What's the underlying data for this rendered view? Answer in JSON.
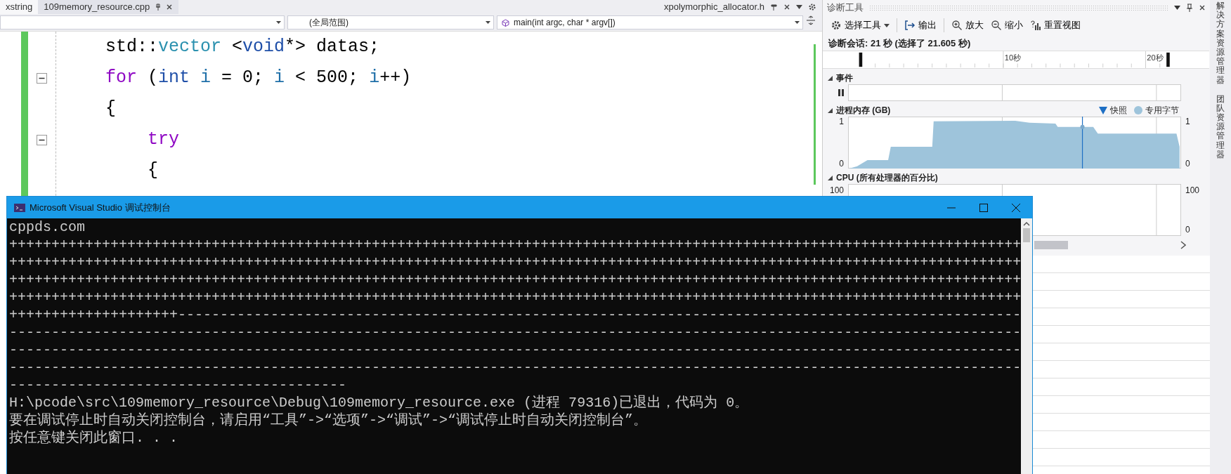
{
  "editor": {
    "tabs": [
      {
        "label": "xstring",
        "selected": false
      },
      {
        "label": "109memory_resource.cpp",
        "selected": true
      }
    ],
    "preview_tab": {
      "label": "xpolymorphic_allocator.h"
    },
    "nav": {
      "scope": "(全局范围)",
      "member": "main(int argc, char * argv[])"
    },
    "code_lines": [
      {
        "foldable": false,
        "tokens": [
          {
            "text": "    std::",
            "kind": "plain"
          },
          {
            "text": "vector",
            "kind": "type"
          },
          {
            "text": " <",
            "kind": "plain"
          },
          {
            "text": "void",
            "kind": "keyword"
          },
          {
            "text": "*> datas;",
            "kind": "plain"
          }
        ]
      },
      {
        "foldable": true,
        "tokens": [
          {
            "text": "    for",
            "kind": "control"
          },
          {
            "text": " (",
            "kind": "plain"
          },
          {
            "text": "int ",
            "kind": "keyword"
          },
          {
            "text": "i",
            "kind": "local"
          },
          {
            "text": " = 0; ",
            "kind": "plain"
          },
          {
            "text": "i",
            "kind": "local"
          },
          {
            "text": " < 500; ",
            "kind": "plain"
          },
          {
            "text": "i",
            "kind": "local"
          },
          {
            "text": "++)",
            "kind": "plain"
          }
        ]
      },
      {
        "foldable": false,
        "tokens": [
          {
            "text": "    {",
            "kind": "plain"
          }
        ]
      },
      {
        "foldable": true,
        "tokens": [
          {
            "text": "        try",
            "kind": "control"
          }
        ]
      },
      {
        "foldable": false,
        "tokens": [
          {
            "text": "        {",
            "kind": "plain"
          }
        ]
      }
    ]
  },
  "diagnostics": {
    "title": "诊断工具",
    "toolbar": [
      {
        "label": "选择工具",
        "kind": "menu"
      },
      {
        "label": "输出",
        "kind": "output"
      },
      {
        "label": "放大",
        "kind": "zoom-in"
      },
      {
        "label": "缩小",
        "kind": "zoom-out"
      },
      {
        "label": "重置视图",
        "kind": "reset"
      }
    ],
    "session": "诊断会话: 21 秒 (选择了 21.605 秒)",
    "ruler": [
      "10秒",
      "20秒"
    ],
    "events": {
      "title": "事件",
      "expanded": true
    },
    "memory": {
      "title": "进程内存 (GB)",
      "expanded": true,
      "snapshot_legend": "快照",
      "bytes_legend": "专用字节",
      "left_ticks": [
        "1",
        "0"
      ],
      "right_ticks": [
        "1",
        "0"
      ]
    },
    "cpu": {
      "title": "CPU (所有处理器的百分比)",
      "expanded": true,
      "left_ticks": [
        "100"
      ],
      "right_ticks": [
        "100",
        "0"
      ]
    }
  },
  "side_tabs": [
    {
      "label": "解决方案资源管理器"
    },
    {
      "label": "团队资源管理器"
    }
  ],
  "console": {
    "title": "Microsoft Visual Studio 调试控制台",
    "lines": [
      "cppds.com",
      "++++++++++++++++++++++++++++++++++++++++++++++++++++++++++++++++++++++++++++++++++++++++++++++++++++++++++++++++++++++++",
      "++++++++++++++++++++++++++++++++++++++++++++++++++++++++++++++++++++++++++++++++++++++++++++++++++++++++++++++++++++++++",
      "++++++++++++++++++++++++++++++++++++++++++++++++++++++++++++++++++++++++++++++++++++++++++++++++++++++++++++++++++++++++",
      "++++++++++++++++++++++++++++++++++++++++++++++++++++++++++++++++++++++++++++++++++++++++++++++++++++++++++++++++++++++++",
      "++++++++++++++++++++----------------------------------------------------------------------------------------------------",
      "------------------------------------------------------------------------------------------------------------------------",
      "------------------------------------------------------------------------------------------------------------------------",
      "------------------------------------------------------------------------------------------------------------------------",
      "----------------------------------------",
      "H:\\pcode\\src\\109memory_resource\\Debug\\109memory_resource.exe (进程 79316)已退出，代码为 0。",
      "要在调试停止时自动关闭控制台，请启用“工具”->“选项”->“调试”->“调试停止时自动关闭控制台”。",
      "按任意键关闭此窗口. . ."
    ]
  }
}
